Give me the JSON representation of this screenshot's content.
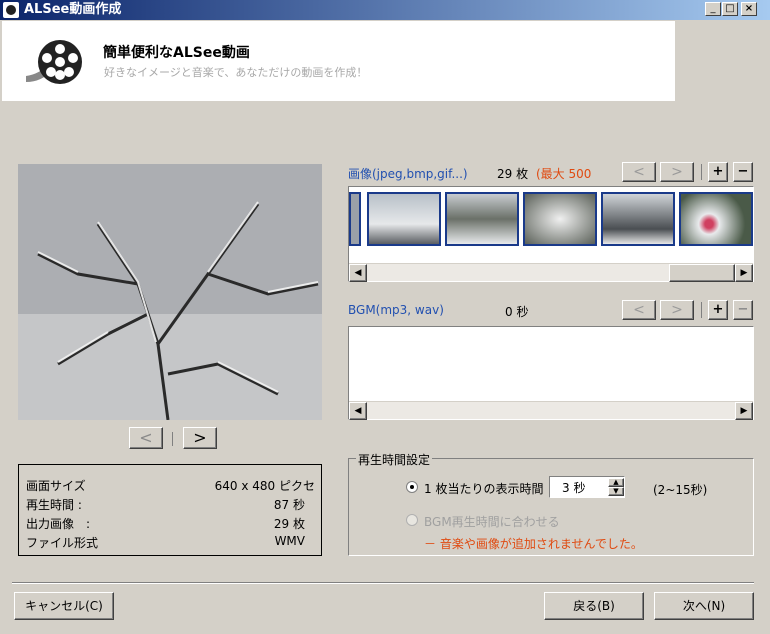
{
  "window": {
    "title": "ALSee動画作成",
    "minimize": "_",
    "maximize": "□",
    "close": "×"
  },
  "header": {
    "title": "簡単便利なALSee動画",
    "subtitle": "好きなイメージと音楽で、あなただけの動画を作成！"
  },
  "preview": {
    "prev": "<",
    "next": ">"
  },
  "info": {
    "rows": [
      {
        "label": "画面サイズ",
        "value": "640 x 480 ピクセ"
      },
      {
        "label": "再生時間 :",
        "value": "87 秒"
      },
      {
        "label": "出力画像　:",
        "value": "29 枚"
      },
      {
        "label": "ファイル形式",
        "value": "WMV"
      }
    ]
  },
  "images": {
    "label": "画像(jpeg,bmp,gif...)",
    "count": "29 枚",
    "max": "(最大 500",
    "prev": "<",
    "next": ">",
    "add": "+",
    "remove": "−"
  },
  "bgm": {
    "label": "BGM(mp3, wav)",
    "duration": "0 秒",
    "prev": "<",
    "next": ">",
    "add": "+",
    "remove": "−"
  },
  "playback": {
    "group_title": "再生時間設定",
    "option1": "1 枚当たりの表示時間",
    "seconds_value": "3 秒",
    "range": "(2~15秒)",
    "option2": "BGM再生時間に合わせる",
    "warning": "－ 音楽や画像が追加されませんでした。"
  },
  "scroll": {
    "left": "◀",
    "right": "▶"
  },
  "buttons": {
    "cancel": "キャンセル(C)",
    "back": "戻る(B)",
    "next": "次へ(N)"
  },
  "colors": {
    "accent_blue": "#2250b0",
    "warning_orange": "#e04a10",
    "title_bar": "#0a246a"
  }
}
